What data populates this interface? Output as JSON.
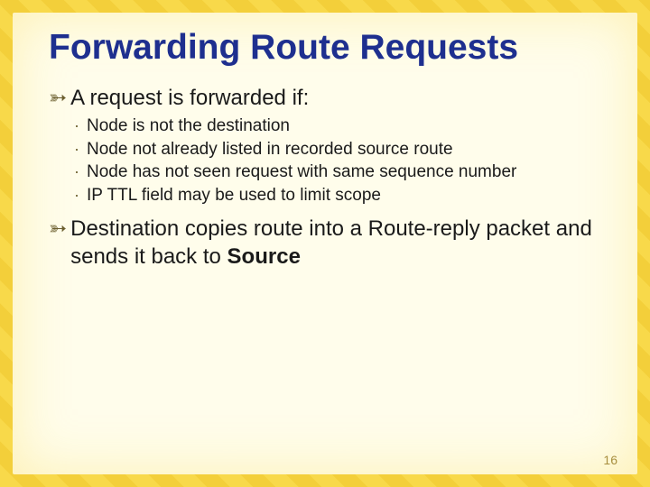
{
  "title": "Forwarding Route Requests",
  "bullets": {
    "main1": "A request is forwarded if:",
    "main2_pre": "Destination copies route into a Route-reply packet and sends it back to ",
    "main2_bold": "Source",
    "sub": [
      "Node is not the destination",
      "Node not already listed in recorded source route",
      "Node has not seen request with same sequence number",
      "IP TTL field may be used to limit scope"
    ]
  },
  "page_number": "16"
}
